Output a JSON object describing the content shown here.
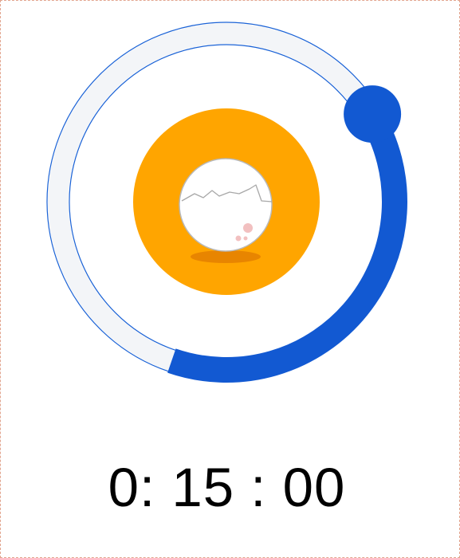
{
  "timer": {
    "display": "0: 15 : 00",
    "progress_fraction": 0.39
  },
  "icon": {
    "name": "egg-timer-icon"
  },
  "colors": {
    "track_fill": "#f3f5f8",
    "track_outline": "#1a62d6",
    "progress": "#1259d2",
    "yolk": "#ffa500",
    "egg": "#ffffff",
    "egg_outline": "#b9b9b9",
    "shadow": "#e88500",
    "dots": "#f2c0c0",
    "page_border": "#e2a58f"
  }
}
